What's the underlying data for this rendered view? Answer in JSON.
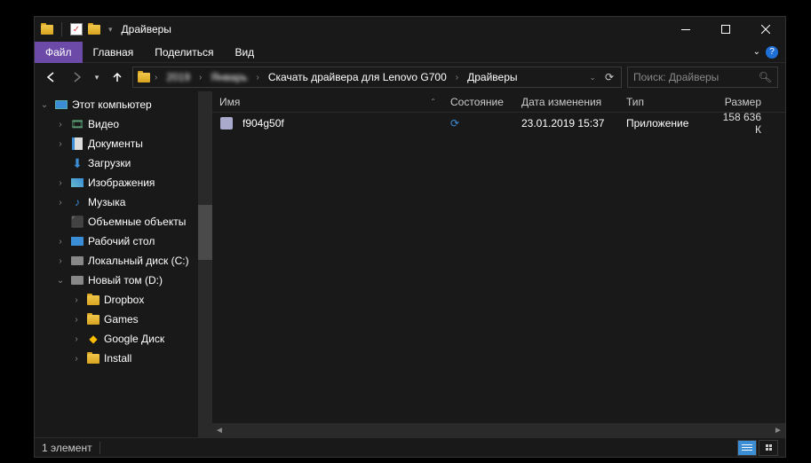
{
  "window": {
    "title": "Драйверы"
  },
  "ribbon": {
    "file": "Файл",
    "home": "Главная",
    "share": "Поделиться",
    "view": "Вид"
  },
  "breadcrumbs": {
    "hidden1": "2019",
    "hidden2": "Январь",
    "path1": "Скачать драйвера для Lenovo G700",
    "path2": "Драйверы"
  },
  "search": {
    "placeholder": "Поиск: Драйверы"
  },
  "sidebar": {
    "this_pc": "Этот компьютер",
    "video": "Видео",
    "documents": "Документы",
    "downloads": "Загрузки",
    "pictures": "Изображения",
    "music": "Музыка",
    "objects3d": "Объемные объекты",
    "desktop": "Рабочий стол",
    "local_disk": "Локальный диск (C:)",
    "new_volume": "Новый том (D:)",
    "dropbox": "Dropbox",
    "games": "Games",
    "google_drive": "Google Диск",
    "install": "Install"
  },
  "columns": {
    "name": "Имя",
    "state": "Состояние",
    "modified": "Дата изменения",
    "type": "Тип",
    "size": "Размер"
  },
  "files": [
    {
      "name": "f904g50f",
      "state": "sync",
      "modified": "23.01.2019 15:37",
      "type": "Приложение",
      "size": "158 636 К"
    }
  ],
  "statusbar": {
    "count": "1 элемент"
  }
}
